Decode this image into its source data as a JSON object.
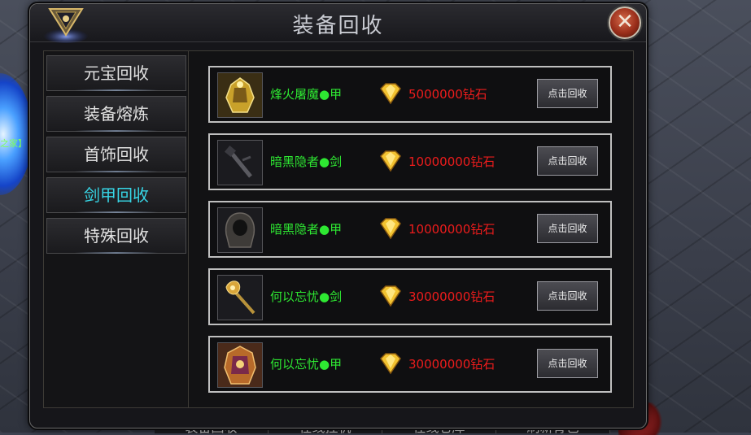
{
  "background": {
    "left_text": "之家】",
    "right_text": "】",
    "bottom_tabs": [
      "装备回收",
      "在线挂机",
      "在线仓库",
      "刷新背包"
    ]
  },
  "window": {
    "title": "装备回收",
    "close_glyph": "✕"
  },
  "sidebar": {
    "items": [
      {
        "label": "元宝回收",
        "active": false
      },
      {
        "label": "装备熔炼",
        "active": false
      },
      {
        "label": "首饰回收",
        "active": false
      },
      {
        "label": "剑甲回收",
        "active": true
      },
      {
        "label": "特殊回收",
        "active": false
      }
    ]
  },
  "recycle_list": [
    {
      "name": "烽火屠魔●甲",
      "price": "5000000钻石",
      "button": "点击回收",
      "icon": "golden-armor-icon"
    },
    {
      "name": "暗黑隐者●剑",
      "price": "10000000钻石",
      "button": "点击回收",
      "icon": "dark-sword-icon"
    },
    {
      "name": "暗黑隐者●甲",
      "price": "10000000钻石",
      "button": "点击回收",
      "icon": "dark-hooded-armor-icon"
    },
    {
      "name": "何以忘忧●剑",
      "price": "30000000钻石",
      "button": "点击回收",
      "icon": "golden-axe-sword-icon"
    },
    {
      "name": "何以忘忧●甲",
      "price": "30000000钻石",
      "button": "点击回收",
      "icon": "ornate-armor-icon"
    }
  ],
  "colors": {
    "item_name": "#2ee832",
    "price": "#ee1c1c",
    "active_tab": "#37d6e6"
  }
}
